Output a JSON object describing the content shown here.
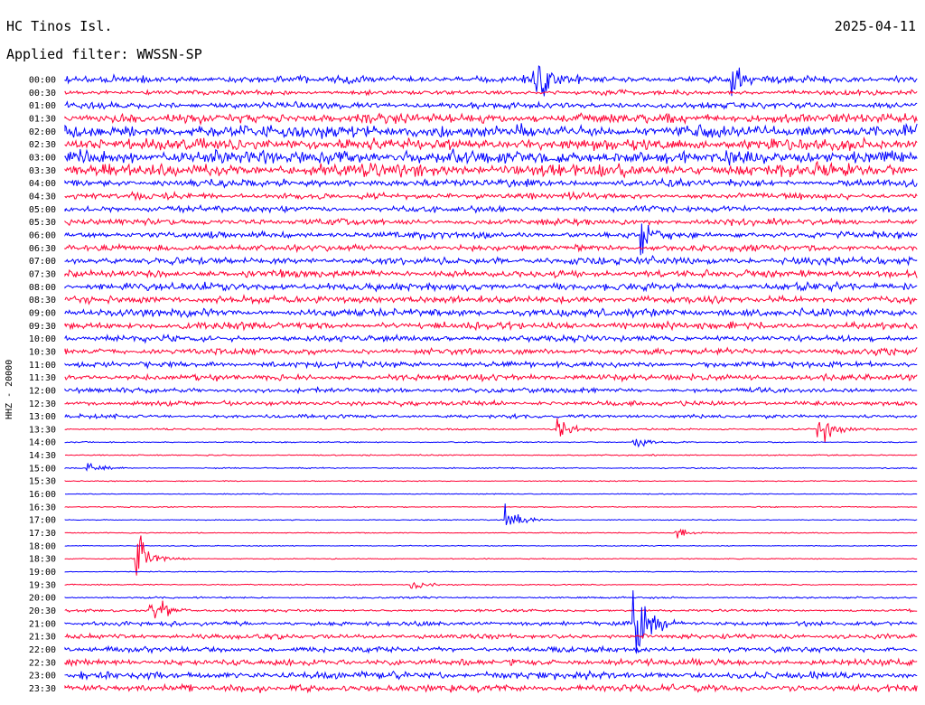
{
  "header": {
    "station": "HC Tinos Isl.",
    "date": "2025-04-11",
    "filter": "Applied filter: WWSSN-SP",
    "channel": "HHZ - 20000"
  },
  "colors": {
    "even_trace": "#0000ff",
    "odd_trace": "#ff0033",
    "background": "#ffffff"
  },
  "chart_data": {
    "type": "line",
    "title": "HC Tinos Isl.",
    "subtitle": "Applied filter: WWSSN-SP",
    "ylabel": "HHZ - 20000",
    "row_labels": [
      "00:00",
      "00:30",
      "01:00",
      "01:30",
      "02:00",
      "02:30",
      "03:00",
      "03:30",
      "04:00",
      "04:30",
      "05:00",
      "05:30",
      "06:00",
      "06:30",
      "07:00",
      "07:30",
      "08:00",
      "08:30",
      "09:00",
      "09:30",
      "10:00",
      "10:30",
      "11:00",
      "11:30",
      "12:00",
      "12:30",
      "13:00",
      "13:30",
      "14:00",
      "14:30",
      "15:00",
      "15:30",
      "16:00",
      "16:30",
      "17:00",
      "17:30",
      "18:00",
      "18:30",
      "19:00",
      "19:30",
      "20:00",
      "20:30",
      "21:00",
      "21:30",
      "22:00",
      "22:30",
      "23:00",
      "23:30"
    ],
    "row_minutes": 30,
    "noise_level": [
      6,
      4,
      5,
      8,
      10,
      9,
      11,
      10,
      6,
      5,
      5,
      5,
      5,
      5,
      6,
      6,
      6,
      6,
      6,
      6,
      5,
      5,
      5,
      5,
      4,
      4,
      3,
      1.5,
      1,
      1,
      1,
      0.8,
      0.8,
      0.8,
      0.8,
      0.8,
      0.8,
      0.8,
      0.8,
      1,
      1.5,
      2,
      3.5,
      4,
      4.5,
      5,
      6,
      6
    ],
    "events": [
      {
        "row": 0,
        "minute": 23.5,
        "amp": 22
      },
      {
        "row": 0,
        "minute": 16.5,
        "amp": 40
      },
      {
        "row": 12,
        "minute": 20.3,
        "amp": 28
      },
      {
        "row": 27,
        "minute": 17.3,
        "amp": 22
      },
      {
        "row": 27,
        "minute": 26.5,
        "amp": 26
      },
      {
        "row": 28,
        "minute": 20,
        "amp": 14
      },
      {
        "row": 30,
        "minute": 0.8,
        "amp": 12
      },
      {
        "row": 34,
        "minute": 15.5,
        "amp": 26
      },
      {
        "row": 35,
        "minute": 21.5,
        "amp": 14
      },
      {
        "row": 37,
        "minute": 2.5,
        "amp": 42
      },
      {
        "row": 39,
        "minute": 12.2,
        "amp": 9
      },
      {
        "row": 41,
        "minute": 3,
        "amp": 32
      },
      {
        "row": 42,
        "minute": 20,
        "amp": 90
      }
    ]
  }
}
